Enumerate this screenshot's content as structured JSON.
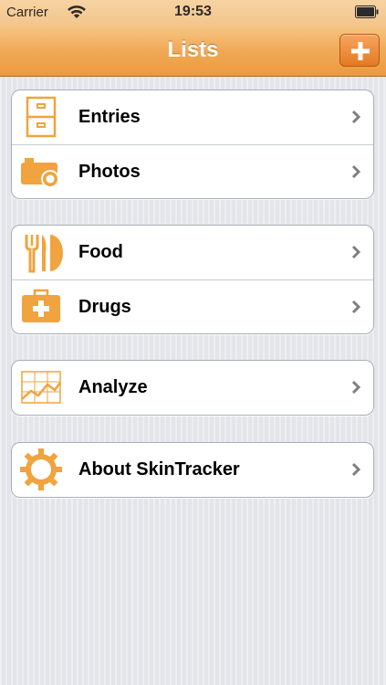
{
  "status_bar": {
    "carrier": "Carrier",
    "time": "19:53",
    "wifi_icon": "wifi-icon",
    "battery_icon": "battery-icon"
  },
  "nav_bar": {
    "title": "Lists",
    "add_icon": "plus-icon"
  },
  "colors": {
    "nav_orange": "#f0a956",
    "icon_orange": "#f0a33e",
    "chevron": "#7f7f7f"
  },
  "groups": [
    {
      "rows": [
        {
          "label": "Entries",
          "icon": "file-cabinet-icon"
        },
        {
          "label": "Photos",
          "icon": "camera-icon"
        }
      ]
    },
    {
      "rows": [
        {
          "label": "Food",
          "icon": "fork-knife-plate-icon"
        },
        {
          "label": "Drugs",
          "icon": "first-aid-kit-icon"
        }
      ]
    },
    {
      "rows": [
        {
          "label": "Analyze",
          "icon": "line-chart-icon"
        }
      ]
    },
    {
      "rows": [
        {
          "label": "About SkinTracker",
          "icon": "gear-icon"
        }
      ]
    }
  ]
}
